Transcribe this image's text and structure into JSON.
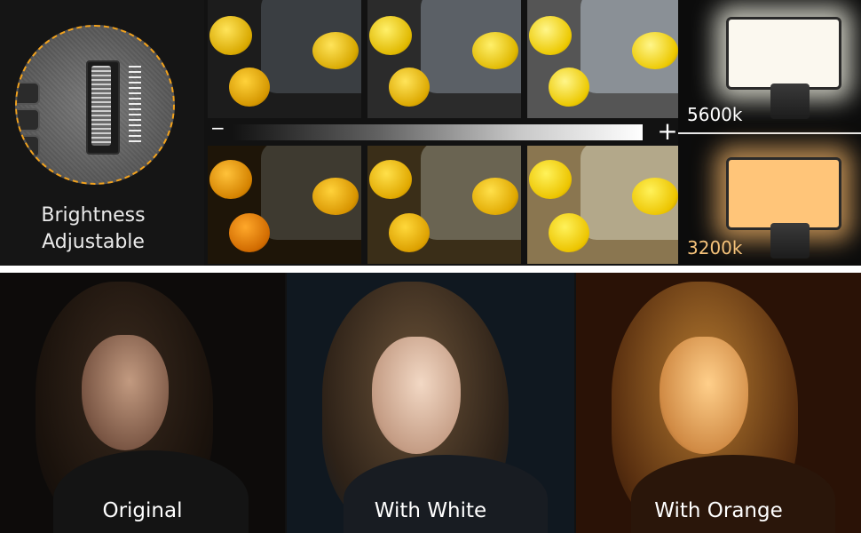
{
  "brightness_label_line1": "Brightness",
  "brightness_label_line2": "Adjustable",
  "scale_minus": "−",
  "scale_plus": "+",
  "temp_cool": "5600k",
  "temp_warm": "3200k",
  "captions": {
    "original": "Original",
    "white": "With White",
    "orange": "With Orange"
  },
  "colors": {
    "accent_orange": "#f2a21d",
    "warm_text": "#f5c27a",
    "cool_text": "#ffffff"
  }
}
